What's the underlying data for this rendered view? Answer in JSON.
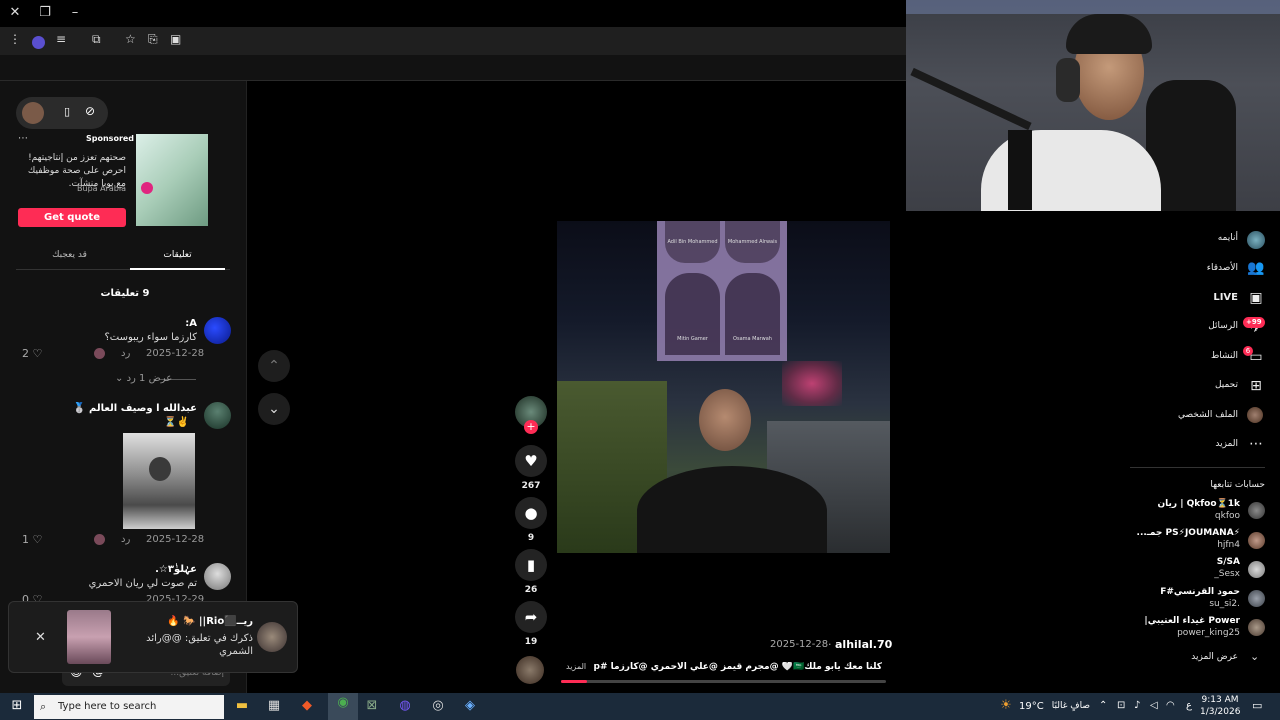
{
  "browser": {
    "window_controls": {
      "close": "✕",
      "restore": "❐",
      "minimize": "–"
    }
  },
  "left": {
    "ad": {
      "sponsored": "Sponsored",
      "text": "صحتهم تعزز من إنتاجيتهم! احرص على صحة موظفيك مع بوبا منشآت.",
      "advertiser": "Bupa Arabia",
      "cta": "Get quote"
    },
    "tabs": {
      "you_may_like": "قد يعجبك",
      "comments": "تعليقات"
    },
    "comments_count_label": "9 تعليقات",
    "comments": [
      {
        "name": "A:",
        "text": "كارزما سواء ريبوست؟",
        "date": "2025-12-28",
        "reply": "رد",
        "likes": "2",
        "view_replies": "عرض 1 رد"
      },
      {
        "name": "عبدالله ا وصيف العالم 🥈",
        "text": "✌️⏳",
        "date": "2025-12-28",
        "reply": "رد",
        "likes": "1"
      },
      {
        "name": "عہٰلوٰ٣ٰ☆.",
        "text": "تم صوت لي ريان الاحمري",
        "date": "2025-12-29",
        "reply": "رد",
        "likes": "0"
      }
    ],
    "input_placeholder": "إضافة تعليق..."
  },
  "notification": {
    "title": "ريــ⬛Rio|| 🐎 🔥",
    "text": "ذكرك في تعليق: @@رائد الشمري",
    "close": "✕"
  },
  "video": {
    "author": "alhilal.70",
    "date": "2025-12-28",
    "caption": "كلنا معك يابو ملك🇸🇦🤍 @مجرم قيمز @علي الاحمري @كارزما #fyp #كارز...",
    "more": "المزيد",
    "actions": {
      "likes": "267",
      "comments": "9",
      "saves": "26",
      "shares": "19"
    },
    "poster_names": [
      "Adil Bin Mohammed",
      "Mohammed Alrwais",
      "Mitin Gamer",
      "Osama Marwah"
    ]
  },
  "right_nav": {
    "items": [
      "أنايمه",
      "الأصدقاء",
      "LIVE",
      "الرسائل",
      "النشاط",
      "تحميل",
      "الملف الشخصي",
      "المزيد"
    ],
    "messages_badge": "+99",
    "activity_badge": "6",
    "following_title": "حسابات تتابعها",
    "following": [
      {
        "name": "Qkfoo⏳1k | ريان",
        "id": "qkfoo"
      },
      {
        "name": "⚡PS⚡JOUMANA جمـ...",
        "id": "hjfn4"
      },
      {
        "name": "S/SA",
        "id": "_Sesx"
      },
      {
        "name": "حمود القرنسي#F",
        "id": "su_si2."
      },
      {
        "name": "Power غيداء العتيبي|",
        "id": "power_king25"
      }
    ],
    "see_more": "عرض المزيد"
  },
  "taskbar": {
    "search_placeholder": "Type here to search",
    "weather_temp": "19°C",
    "weather_text": "صافٍ غالبًا",
    "lang": "ع",
    "time": "9:13 AM",
    "date": "1/3/2026"
  },
  "colors": {
    "accent": "#fe2c55",
    "panel": "#121212",
    "taskbar": "#1b2a3a"
  }
}
